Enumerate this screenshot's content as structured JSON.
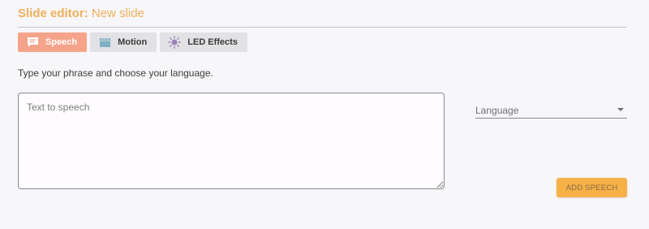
{
  "header": {
    "title_prefix": "Slide editor:",
    "title_name": "New slide"
  },
  "tabs": [
    {
      "label": "Speech",
      "icon": "speech-bubble-icon",
      "active": true
    },
    {
      "label": "Motion",
      "icon": "clapperboard-icon",
      "active": false
    },
    {
      "label": "LED Effects",
      "icon": "sun-icon",
      "active": false
    }
  ],
  "speech": {
    "instruction": "Type your phrase and choose your language.",
    "text_placeholder": "Text to speech",
    "text_value": "",
    "language_label": "Language",
    "add_button_label": "ADD SPEECH"
  },
  "colors": {
    "accent": "#efb05a",
    "active_tab": "#f5a48b",
    "button": "#f5b046",
    "background": "#f7f6f8"
  }
}
